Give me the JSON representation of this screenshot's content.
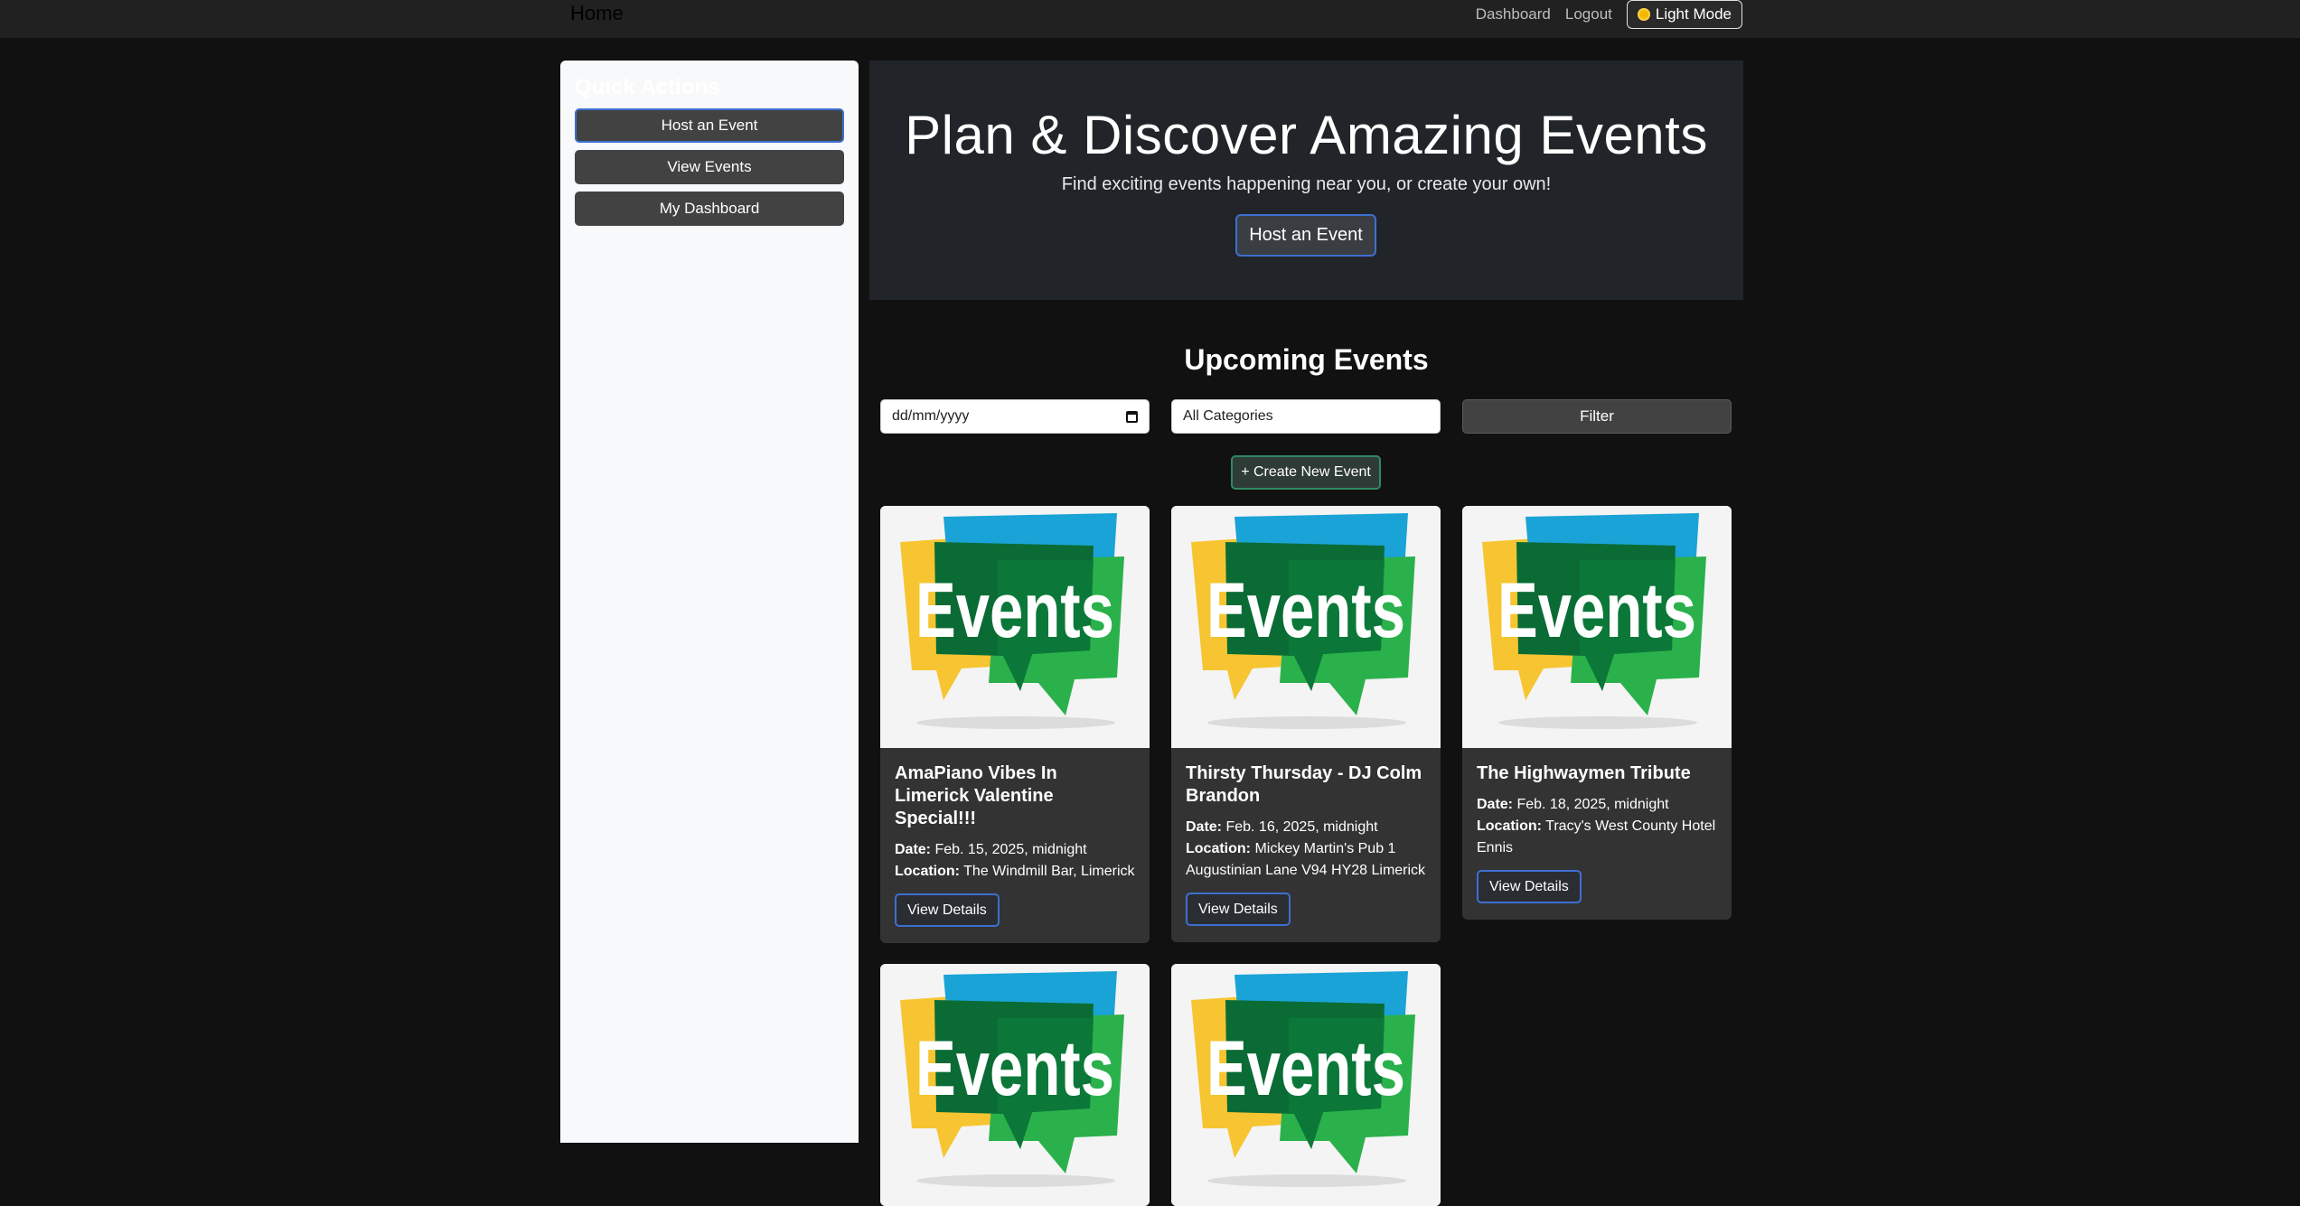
{
  "navbar": {
    "brand": "Home",
    "links": [
      "Dashboard",
      "Logout"
    ],
    "mode_button": "Light Mode",
    "mode_icon": "sun-icon"
  },
  "sidebar": {
    "title": "Quick Actions",
    "buttons": [
      "Host an Event",
      "View Events",
      "My Dashboard"
    ]
  },
  "hero": {
    "title": "Plan & Discover Amazing Events",
    "subtitle": "Find exciting events happening near you, or create your own!",
    "button": "Host an Event"
  },
  "events_section": {
    "title": "Upcoming Events",
    "date_placeholder": "dd/mm/yyyy",
    "category_selected": "All Categories",
    "filter_button": "Filter",
    "create_button": "+ Create New Event"
  },
  "labels": {
    "date": "Date:",
    "location": "Location:",
    "view_details": "View Details"
  },
  "events": [
    {
      "title": "AmaPiano Vibes In Limerick Valentine Special!!!",
      "date": "Feb. 15, 2025, midnight",
      "location": "The Windmill Bar, Limerick",
      "image_text": "Events"
    },
    {
      "title": "Thirsty Thursday - DJ Colm Brandon",
      "date": "Feb. 16, 2025, midnight",
      "location": "Mickey Martin's Pub 1 Augustinian Lane V94 HY28 Limerick",
      "image_text": "Events"
    },
    {
      "title": "The Highwaymen Tribute",
      "date": "Feb. 18, 2025, midnight",
      "location": "Tracy's West County Hotel Ennis",
      "image_text": "Events"
    },
    {
      "image_text": "Events"
    },
    {
      "image_text": "Events"
    }
  ]
}
